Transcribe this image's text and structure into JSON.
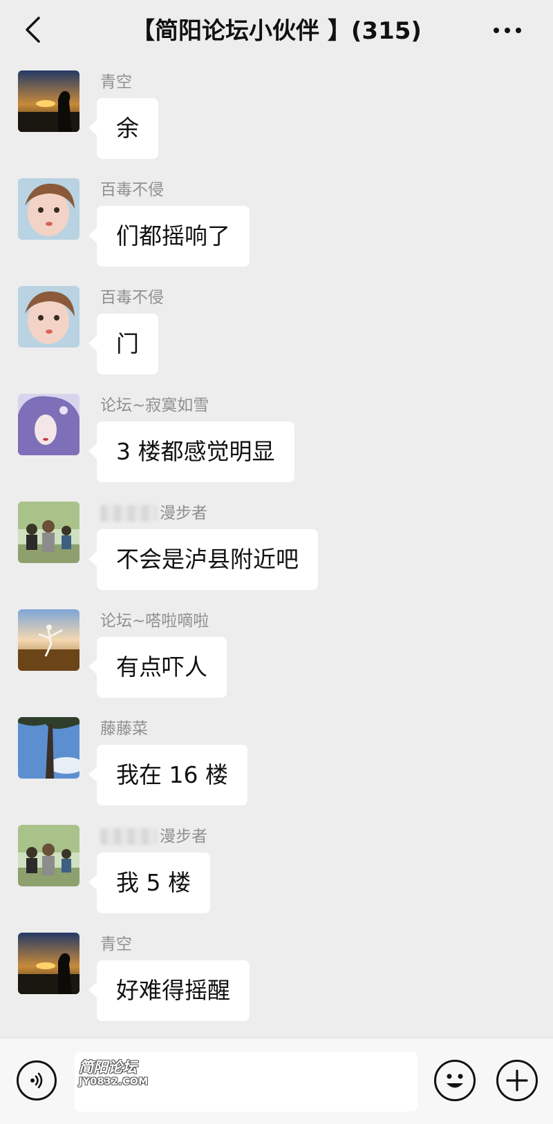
{
  "header": {
    "back_icon": "chevron-left-icon",
    "title": "【简阳论坛小伙伴 】(315)",
    "more_icon": "more-dots-icon"
  },
  "messages": [
    {
      "sender": "青空",
      "text": "余",
      "avatar": "sunset-silhouette"
    },
    {
      "sender": "百毒不侵",
      "text": "们都摇响了",
      "avatar": "child-face"
    },
    {
      "sender": "百毒不侵",
      "text": "门",
      "avatar": "child-face"
    },
    {
      "sender": "论坛~寂寞如雪",
      "text": "3 楼都感觉明显",
      "avatar": "purple-hair-portrait"
    },
    {
      "sender": "漫步者",
      "text": "不会是泸县附近吧",
      "avatar": "park-group-photo"
    },
    {
      "sender": "论坛~嗒啦嘀啦",
      "text": "有点吓人",
      "avatar": "dancer-field-sky"
    },
    {
      "sender": "藤藤菜",
      "text": "我在 16 楼",
      "avatar": "tree-blue-sky"
    },
    {
      "sender": "漫步者",
      "text": "我 5 楼",
      "avatar": "park-group-photo"
    },
    {
      "sender": "青空",
      "text": "好难得摇醒",
      "avatar": "sunset-silhouette"
    }
  ],
  "bottom_bar": {
    "voice_icon": "voice-icon",
    "watermark_line1": "简阳论坛",
    "watermark_line2": "JY0832.COM",
    "emoji_icon": "emoji-icon",
    "plus_icon": "plus-icon"
  },
  "colors": {
    "background": "#ededed",
    "bubble": "#ffffff",
    "sender_text": "#8f8f8f"
  }
}
